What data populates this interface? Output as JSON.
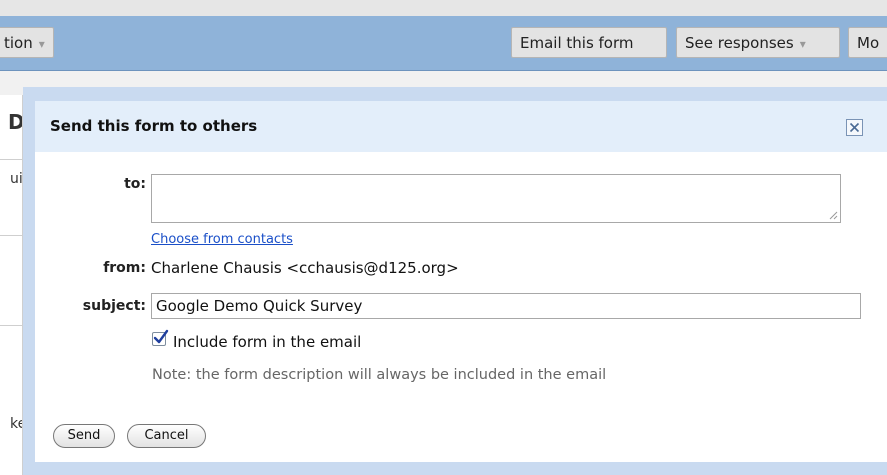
{
  "toolbar": {
    "left_button_label": "tion",
    "email_button_label": "Email this form",
    "responses_button_label": "See responses",
    "more_button_label": "Mo"
  },
  "background": {
    "heading_fragment": "D",
    "fragment_1": "ui",
    "fragment_2": "ke"
  },
  "dialog": {
    "title": "Send this form to others",
    "to_label": "to:",
    "to_value": "",
    "choose_contacts_link": "Choose from contacts",
    "from_label": "from:",
    "from_value": "Charlene Chausis <cchausis@d125.org>",
    "subject_label": "subject:",
    "subject_value": "Google Demo Quick Survey",
    "include_form_label": "Include form in the email",
    "include_form_checked": true,
    "note": "Note: the form description will always be included in the email",
    "send_label": "Send",
    "cancel_label": "Cancel"
  }
}
